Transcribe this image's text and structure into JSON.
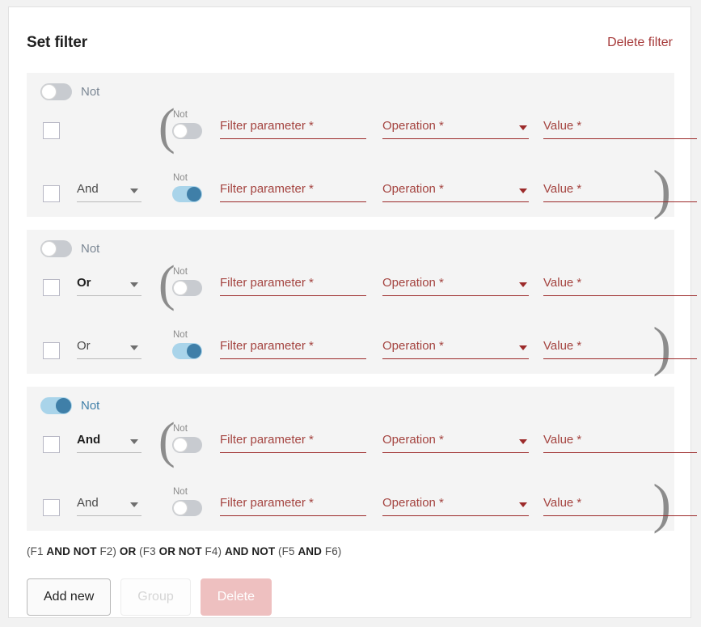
{
  "header": {
    "title": "Set filter",
    "delete_filter_label": "Delete filter"
  },
  "labels": {
    "not": "Not",
    "filter_parameter_placeholder": "Filter parameter *",
    "operation_placeholder": "Operation *",
    "value_placeholder": "Value *"
  },
  "colors": {
    "card_background": "#ffffff",
    "group_background": "#f4f4f4",
    "page_background": "#f2f2f2",
    "accent_blue": "#3f7fa8",
    "toggle_on_track": "#a9d4ea",
    "toggle_off_track": "#c8cbd0",
    "error_red": "#a4433f",
    "link_red": "#a63a3a",
    "delete_button_pink": "#eec0c0"
  },
  "groups": [
    {
      "group_not_on": false,
      "group_not_label": "Not",
      "rows": [
        {
          "checked": false,
          "connector": null,
          "connector_primary": false,
          "not_caption": "Not",
          "not_on": false,
          "open_paren": "(",
          "close_paren": null,
          "filter_parameter": "Filter parameter *",
          "operation": "Operation *",
          "value": "Value *"
        },
        {
          "checked": false,
          "connector": "And",
          "connector_primary": false,
          "not_caption": "Not",
          "not_on": true,
          "open_paren": null,
          "close_paren": ")",
          "filter_parameter": "Filter parameter *",
          "operation": "Operation *",
          "value": "Value *"
        }
      ]
    },
    {
      "group_not_on": false,
      "group_not_label": "Not",
      "rows": [
        {
          "checked": false,
          "connector": "Or",
          "connector_primary": true,
          "not_caption": "Not",
          "not_on": false,
          "open_paren": "(",
          "close_paren": null,
          "filter_parameter": "Filter parameter *",
          "operation": "Operation *",
          "value": "Value *"
        },
        {
          "checked": false,
          "connector": "Or",
          "connector_primary": false,
          "not_caption": "Not",
          "not_on": true,
          "open_paren": null,
          "close_paren": ")",
          "filter_parameter": "Filter parameter *",
          "operation": "Operation *",
          "value": "Value *"
        }
      ]
    },
    {
      "group_not_on": true,
      "group_not_label": "Not",
      "rows": [
        {
          "checked": false,
          "connector": "And",
          "connector_primary": true,
          "not_caption": "Not",
          "not_on": false,
          "open_paren": "(",
          "close_paren": null,
          "filter_parameter": "Filter parameter *",
          "operation": "Operation *",
          "value": "Value *"
        },
        {
          "checked": false,
          "connector": "And",
          "connector_primary": false,
          "not_caption": "Not",
          "not_on": false,
          "open_paren": null,
          "close_paren": ")",
          "filter_parameter": "Filter parameter *",
          "operation": "Operation *",
          "value": "Value *"
        }
      ]
    }
  ],
  "formula": {
    "parts": [
      {
        "text": "(F1 ",
        "bold": false
      },
      {
        "text": "AND NOT",
        "bold": true
      },
      {
        "text": " F2) ",
        "bold": false
      },
      {
        "text": "OR",
        "bold": true
      },
      {
        "text": " (F3 ",
        "bold": false
      },
      {
        "text": "OR NOT",
        "bold": true
      },
      {
        "text": " F4) ",
        "bold": false
      },
      {
        "text": "AND NOT",
        "bold": true
      },
      {
        "text": " (F5 ",
        "bold": false
      },
      {
        "text": "AND",
        "bold": true
      },
      {
        "text": " F6)",
        "bold": false
      }
    ]
  },
  "buttons": {
    "add_new": {
      "label": "Add new",
      "enabled": true
    },
    "group": {
      "label": "Group",
      "enabled": false
    },
    "delete": {
      "label": "Delete",
      "enabled": false
    }
  }
}
